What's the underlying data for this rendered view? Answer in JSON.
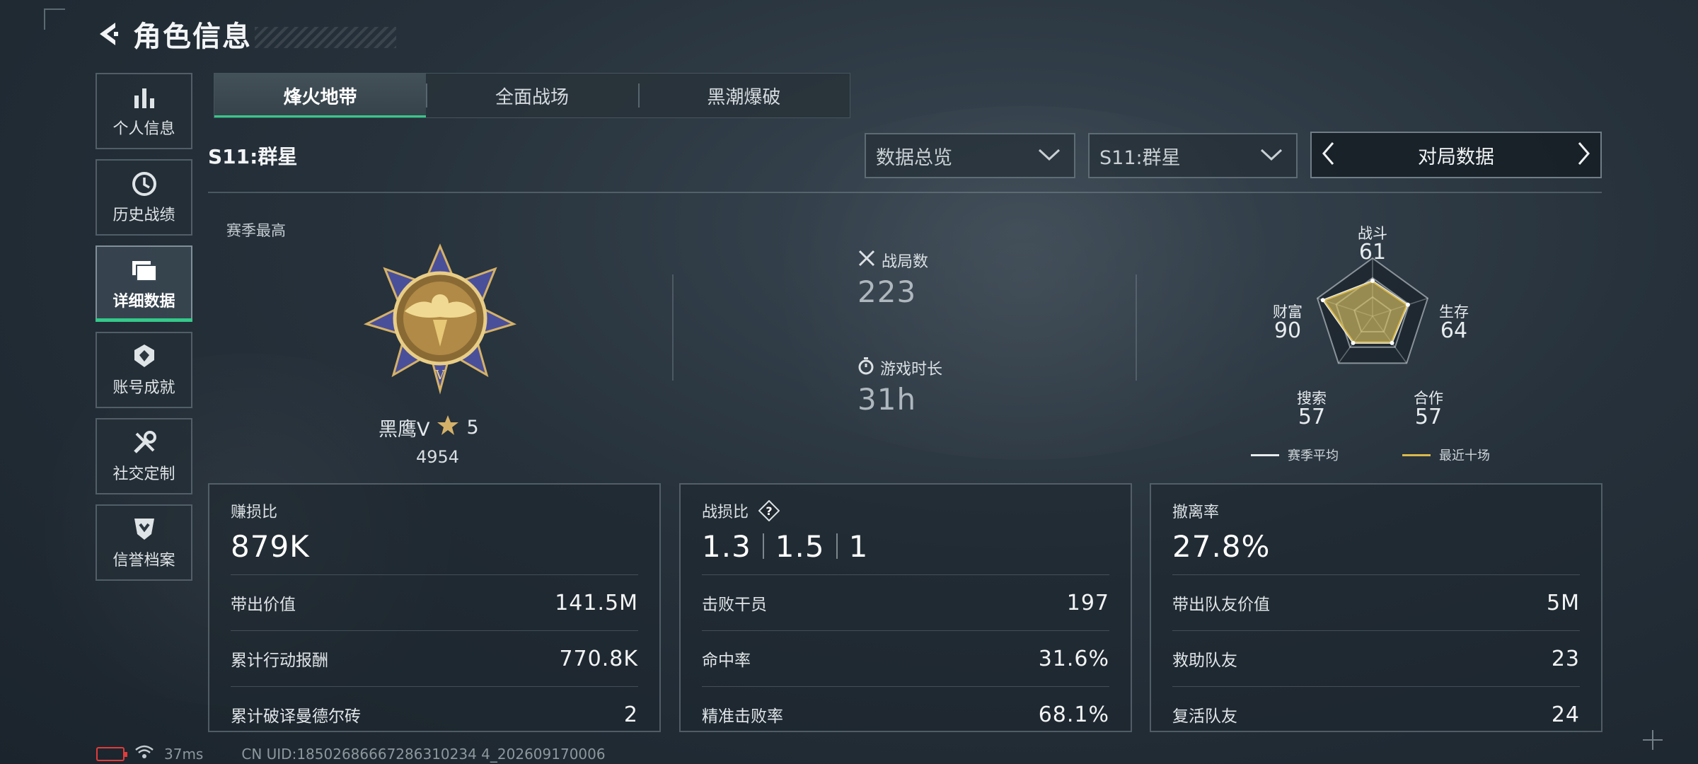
{
  "header": {
    "title": "角色信息",
    "back_icon": "back-arrow-icon"
  },
  "sidebar": {
    "items": [
      {
        "label": "个人信息",
        "icon": "bar-chart-icon",
        "active": false
      },
      {
        "label": "历史战绩",
        "icon": "clock-icon",
        "active": false
      },
      {
        "label": "详细数据",
        "icon": "folder-icon",
        "active": true
      },
      {
        "label": "账号成就",
        "icon": "badge-icon",
        "active": false
      },
      {
        "label": "社交定制",
        "icon": "wrench-icon",
        "active": false
      },
      {
        "label": "信誉档案",
        "icon": "shield-icon",
        "active": false
      }
    ]
  },
  "tabs": [
    {
      "label": "烽火地带",
      "active": true
    },
    {
      "label": "全面战场",
      "active": false
    },
    {
      "label": "黑潮爆破",
      "active": false
    }
  ],
  "season": {
    "label": "S11:群星",
    "dropdown_overview": "数据总览",
    "dropdown_season": "S11:群星",
    "pager_title": "对局数据"
  },
  "summary": {
    "best_label": "赛季最高",
    "rank_name": "黑鹰Ⅴ",
    "rank_stars": "5",
    "rank_score": "4954",
    "matches_label": "战局数",
    "matches_value": "223",
    "playtime_label": "游戏时长",
    "playtime_value": "31h"
  },
  "radar": {
    "axes": [
      {
        "label": "战斗",
        "value": "61"
      },
      {
        "label": "生存",
        "value": "64"
      },
      {
        "label": "合作",
        "value": "57"
      },
      {
        "label": "搜索",
        "value": "57"
      },
      {
        "label": "财富",
        "value": "90"
      }
    ],
    "legend_avg": "赛季平均",
    "legend_recent": "最近十场",
    "color_avg": "#e8ecee",
    "color_recent": "#d9b94a"
  },
  "cards": {
    "profit": {
      "title": "赚损比",
      "big": "879K",
      "rows": [
        {
          "label": "带出价值",
          "value": "141.5M"
        },
        {
          "label": "累计行动报酬",
          "value": "770.8K"
        },
        {
          "label": "累计破译曼德尔砖",
          "value": "2"
        }
      ]
    },
    "kd": {
      "title": "战损比",
      "ratios": [
        "1.3",
        "1.5",
        "1"
      ],
      "rows": [
        {
          "label": "击败干员",
          "value": "197"
        },
        {
          "label": "命中率",
          "value": "31.6%"
        },
        {
          "label": "精准击败率",
          "value": "68.1%"
        }
      ]
    },
    "extract": {
      "title": "撤离率",
      "big": "27.8%",
      "rows": [
        {
          "label": "带出队友价值",
          "value": "5M"
        },
        {
          "label": "救助队友",
          "value": "23"
        },
        {
          "label": "复活队友",
          "value": "24"
        }
      ]
    }
  },
  "footer": {
    "ping": "37ms",
    "uid": "CN UID:18502686667286310234 4_202609170006"
  },
  "colors": {
    "accent": "#35c98a",
    "battery_low": "#e23b3b"
  }
}
